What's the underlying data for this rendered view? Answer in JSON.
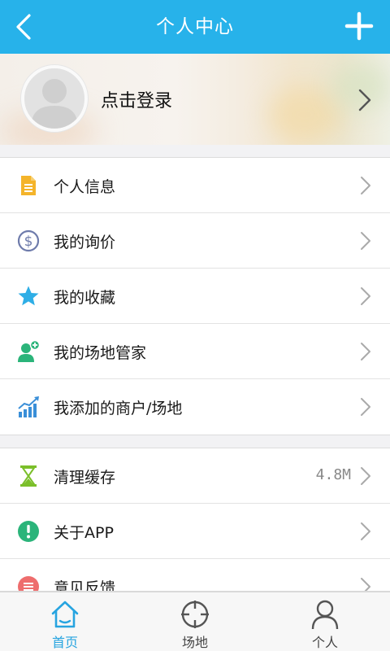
{
  "header": {
    "title": "个人中心",
    "back_icon": "back-arrow-icon",
    "add_icon": "plus-icon"
  },
  "profile": {
    "login_label": "点击登录",
    "avatar_icon": "default-avatar-icon"
  },
  "menu_group_1": [
    {
      "label": "个人信息",
      "icon": "document-icon",
      "color": "#f4b42a"
    },
    {
      "label": "我的询价",
      "icon": "dollar-icon",
      "color": "#6e7bab"
    },
    {
      "label": "我的收藏",
      "icon": "star-icon",
      "color": "#2eaee6"
    },
    {
      "label": "我的场地管家",
      "icon": "add-user-icon",
      "color": "#2bb47a"
    },
    {
      "label": "我添加的商户/场地",
      "icon": "chart-bars-icon",
      "color": "#3a8fd8"
    }
  ],
  "menu_group_2": [
    {
      "label": "清理缓存",
      "icon": "hourglass-icon",
      "color": "#7bbf2a",
      "value": "4.8M"
    },
    {
      "label": "关于APP",
      "icon": "info-icon",
      "color": "#2bb47a"
    },
    {
      "label": "意见反馈",
      "icon": "feedback-icon",
      "color": "#ee6d6d"
    }
  ],
  "tabs": [
    {
      "label": "首页",
      "icon": "home-icon",
      "active": true
    },
    {
      "label": "场地",
      "icon": "crosshair-icon",
      "active": false
    },
    {
      "label": "个人",
      "icon": "person-icon",
      "active": false
    }
  ],
  "colors": {
    "primary": "#27b2ea",
    "tab_active": "#27a4e0"
  }
}
